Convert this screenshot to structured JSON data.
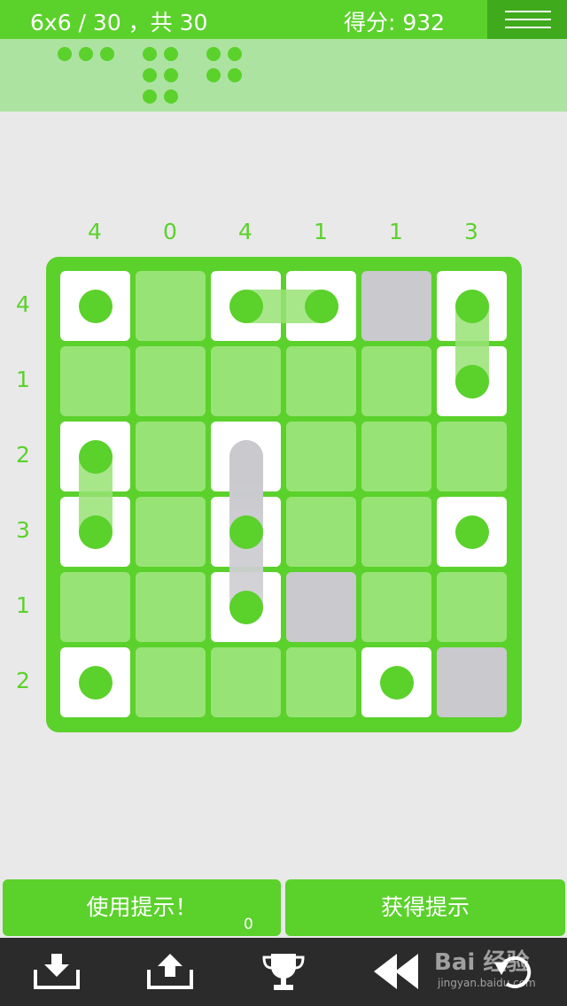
{
  "header": {
    "level": "6x6 / 30 ，共 30",
    "score": "得分: 932"
  },
  "tray": {
    "pieces": [
      {
        "name": "horizontal-3",
        "cells": [
          [
            0,
            0
          ],
          [
            1,
            0
          ],
          [
            2,
            0
          ]
        ]
      },
      {
        "name": "vertical-3-pair",
        "cells": [
          [
            0,
            0
          ],
          [
            1,
            0
          ],
          [
            0,
            1
          ],
          [
            1,
            1
          ],
          [
            0,
            2
          ],
          [
            1,
            2
          ]
        ]
      },
      {
        "name": "square-2x2",
        "cells": [
          [
            0,
            0
          ],
          [
            1,
            0
          ],
          [
            0,
            1
          ],
          [
            1,
            1
          ]
        ]
      }
    ]
  },
  "puzzle": {
    "size": 6,
    "column_clues": [
      "4",
      "0",
      "4",
      "1",
      "1",
      "3"
    ],
    "row_clues": [
      "4",
      "1",
      "2",
      "3",
      "1",
      "2"
    ],
    "cells": [
      [
        "dot",
        "empty",
        "dot",
        "dot",
        "blocked",
        "dot"
      ],
      [
        "empty",
        "empty",
        "empty",
        "empty",
        "empty",
        "dot"
      ],
      [
        "dot",
        "empty",
        "hint",
        "empty",
        "empty",
        "empty"
      ],
      [
        "dot",
        "empty",
        "dot",
        "empty",
        "empty",
        "dot"
      ],
      [
        "empty",
        "empty",
        "dot",
        "blocked",
        "empty",
        "empty"
      ],
      [
        "dot",
        "empty",
        "empty",
        "empty",
        "dot",
        "blocked"
      ]
    ],
    "links": [
      {
        "from": [
          0,
          2
        ],
        "to": [
          0,
          3
        ],
        "style": "green"
      },
      {
        "from": [
          0,
          5
        ],
        "to": [
          1,
          5
        ],
        "style": "green"
      },
      {
        "from": [
          2,
          0
        ],
        "to": [
          3,
          0
        ],
        "style": "green"
      },
      {
        "from": [
          2,
          2
        ],
        "to": [
          4,
          2
        ],
        "style": "gray"
      }
    ]
  },
  "buttons": {
    "use_hint": "使用提示！",
    "hint_count": "0",
    "get_hint": "获得提示"
  },
  "toolbar": {
    "icons": [
      "download-icon",
      "upload-icon",
      "trophy-icon",
      "rewind-icon",
      "undo-icon"
    ]
  },
  "watermark": {
    "brand": "Bai 经验",
    "url": "jingyan.baidu.com"
  },
  "colors": {
    "accent": "#5bd12c",
    "accent_dark": "#3eaa1c",
    "tray_bg": "#ade3a1",
    "empty_cell": "#98e376",
    "blocked_cell": "#c9c9ce",
    "toolbar_bg": "#2b2b2b"
  }
}
